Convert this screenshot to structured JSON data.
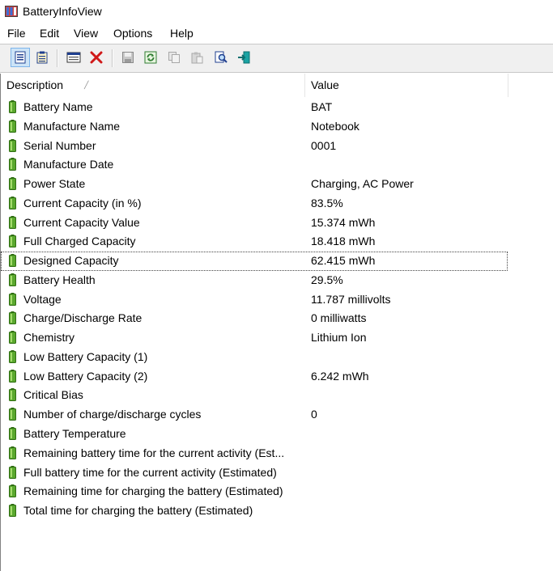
{
  "window": {
    "title": "BatteryInfoView"
  },
  "menu": [
    "File",
    "Edit",
    "View",
    "Options",
    "Help"
  ],
  "toolbar": {
    "buttons": [
      {
        "name": "html-report-icon"
      },
      {
        "name": "properties-icon"
      },
      {
        "name": "window-icon"
      },
      {
        "name": "delete-icon"
      },
      {
        "name": "save-icon"
      },
      {
        "name": "refresh-icon"
      },
      {
        "name": "copy-icon"
      },
      {
        "name": "paste-icon"
      },
      {
        "name": "find-icon"
      },
      {
        "name": "exit-icon"
      }
    ]
  },
  "columns": {
    "description": "Description",
    "value": "Value"
  },
  "rows": [
    {
      "description": "Battery Name",
      "value": "BAT"
    },
    {
      "description": "Manufacture Name",
      "value": "Notebook"
    },
    {
      "description": "Serial Number",
      "value": "0001"
    },
    {
      "description": "Manufacture Date",
      "value": ""
    },
    {
      "description": "Power State",
      "value": "Charging, AC Power"
    },
    {
      "description": "Current Capacity (in %)",
      "value": "83.5%"
    },
    {
      "description": "Current Capacity Value",
      "value": "15.374 mWh"
    },
    {
      "description": "Full Charged Capacity",
      "value": "18.418 mWh"
    },
    {
      "description": "Designed Capacity",
      "value": "62.415 mWh"
    },
    {
      "description": "Battery Health",
      "value": "29.5%"
    },
    {
      "description": "Voltage",
      "value": "11.787 millivolts"
    },
    {
      "description": "Charge/Discharge Rate",
      "value": "0 milliwatts"
    },
    {
      "description": "Chemistry",
      "value": "Lithium Ion"
    },
    {
      "description": "Low Battery Capacity (1)",
      "value": ""
    },
    {
      "description": "Low Battery Capacity (2)",
      "value": "6.242 mWh"
    },
    {
      "description": "Critical Bias",
      "value": ""
    },
    {
      "description": "Number of charge/discharge cycles",
      "value": "0"
    },
    {
      "description": "Battery Temperature",
      "value": ""
    },
    {
      "description": "Remaining battery time for the current activity (Est...",
      "value": ""
    },
    {
      "description": "Full battery time for the current activity (Estimated)",
      "value": ""
    },
    {
      "description": "Remaining time for charging the battery (Estimated)",
      "value": ""
    },
    {
      "description": "Total  time for charging the battery (Estimated)",
      "value": ""
    }
  ],
  "focused_row": "Designed Capacity",
  "colors": {
    "battery_green": "#5aa82e",
    "selection_border": "#7eb4ea"
  }
}
